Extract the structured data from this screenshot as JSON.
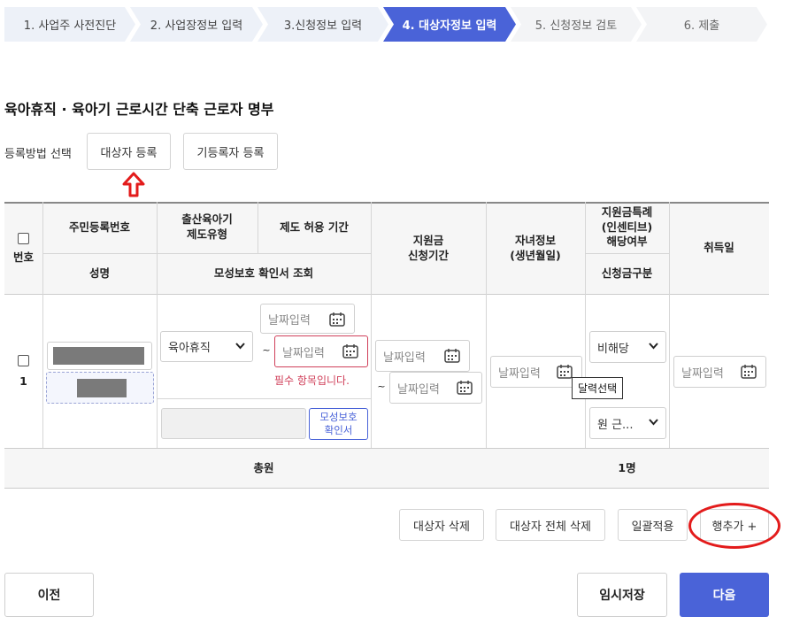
{
  "stepper": {
    "steps": [
      {
        "label": "1. 사업주 사전진단"
      },
      {
        "label": "2. 사업장정보 입력"
      },
      {
        "label": "3.신청정보 입력"
      },
      {
        "label": "4. 대상자정보 입력"
      },
      {
        "label": "5. 신청정보 검토"
      },
      {
        "label": "6. 제출"
      }
    ],
    "active_index": 3
  },
  "section_title": "육아휴직 · 육아기 근로시간 단축 근로자 명부",
  "registration": {
    "label": "등록방법 선택",
    "target_button": "대상자 등록",
    "existing_button": "기등록자 등록"
  },
  "table": {
    "headers": {
      "number": "번호",
      "resident_no": "주민등록번호",
      "name": "성명",
      "leave_type": "출산육아기\n제도유형",
      "allowed_period": "제도 허용 기간",
      "maternity_check": "모성보호 확인서 조회",
      "support_period": "지원금\n신청기간",
      "child_info": "자녀정보\n(생년월일)",
      "incentive": "지원금특례\n(인센티브)\n해당여부",
      "apply_type": "신청금구분",
      "acquisition_date": "취득일"
    },
    "row": {
      "number": "1",
      "leave_type_value": "육아휴직",
      "date_placeholder": "날짜입력",
      "range_sep": "~",
      "error_text": "필수 항목입니다.",
      "maternity_button": "모성보호\n확인서",
      "incentive_value": "비해당",
      "apply_type_value": "원 근...",
      "tooltip": "달력선택"
    },
    "footer": {
      "total_label": "총원",
      "total_value": "1명"
    }
  },
  "actions": {
    "delete_target": "대상자 삭제",
    "delete_all": "대상자 전체 삭제",
    "apply_all": "일괄적용",
    "add_row": "행추가 +"
  },
  "nav": {
    "prev": "이전",
    "temp_save": "임시저장",
    "next": "다음"
  },
  "colors": {
    "accent": "#4a63d8",
    "error": "#d0405a",
    "annotation": "#e31b1b"
  }
}
